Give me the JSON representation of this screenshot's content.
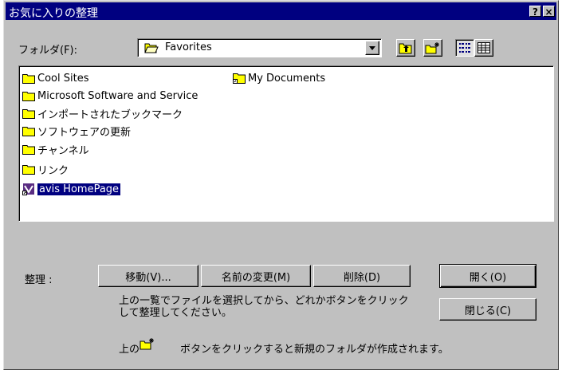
{
  "window": {
    "title": "お気に入りの整理",
    "help_button": "?",
    "close_button": "×"
  },
  "folder_bar": {
    "label": "フォルダ(F):",
    "selected": "Favorites"
  },
  "items": [
    {
      "label": "Cool Sites",
      "icon": "folder-icon"
    },
    {
      "label": "Microsoft Software and Service",
      "icon": "folder-icon"
    },
    {
      "label": "インポートされたブックマーク",
      "icon": "folder-icon"
    },
    {
      "label": "ソフトウェアの更新",
      "icon": "folder-icon"
    },
    {
      "label": "チャンネル",
      "icon": "folder-icon"
    },
    {
      "label": "リンク",
      "icon": "folder-icon"
    },
    {
      "label": "avis HomePage",
      "icon": "shortcut-icon",
      "selected": true
    },
    {
      "label": "My Documents",
      "icon": "folder-shortcut-icon"
    }
  ],
  "organize": {
    "label": "整理 :",
    "move": "移動(V)...",
    "rename": "名前の変更(M)",
    "delete": "削除(D)",
    "open": "開く(O)",
    "close": "閉じる(C)",
    "instruction": "上の一覧でファイルを選択してから、どれかボタンをクリックして整理してください。",
    "new_folder_prefix": "上の",
    "new_folder_suffix": "ボタンをクリックすると新規のフォルダが作成されます。"
  },
  "colors": {
    "title_bar": "#000080",
    "face": "#c0c0c0",
    "selection": "#000080",
    "folder": "#ffff00"
  }
}
